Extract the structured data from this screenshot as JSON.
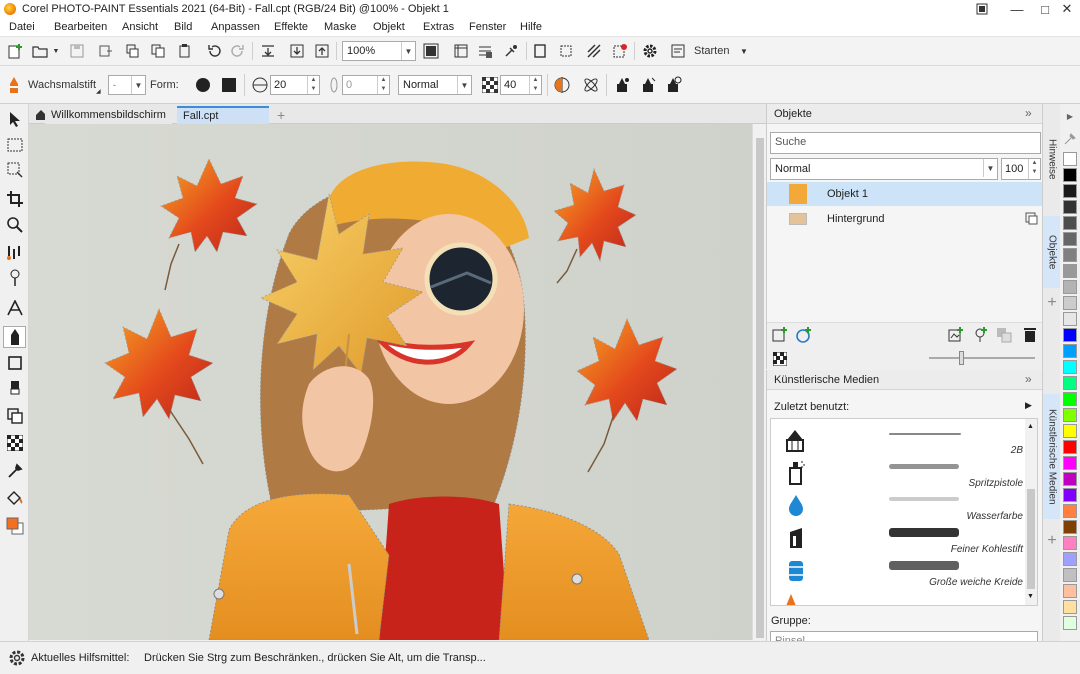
{
  "window": {
    "title": "Corel PHOTO-PAINT Essentials 2021 (64-Bit) - Fall.cpt (RGB/24 Bit) @100% - Objekt 1",
    "minimize": "—",
    "maximize": "□",
    "close": "✕"
  },
  "menu": [
    "Datei",
    "Bearbeiten",
    "Ansicht",
    "Bild",
    "Anpassen",
    "Effekte",
    "Maske",
    "Objekt",
    "Extras",
    "Fenster",
    "Hilfe"
  ],
  "toolbar": {
    "zoom": "100%",
    "launch_label": "Starten"
  },
  "propertybar": {
    "tool_name": "Wachsmalstift",
    "shape_label": "Form:",
    "nib_size": "20",
    "transparency": "0",
    "merge_mode": "Normal",
    "texture": "40",
    "size_combo": "-"
  },
  "document_tabs": [
    {
      "label": "Willkommensbildschirm",
      "active": false
    },
    {
      "label": "Fall.cpt",
      "active": true
    }
  ],
  "objects_panel": {
    "title": "Objekte",
    "search_placeholder": "Suche",
    "blend_mode": "Normal",
    "opacity": "100",
    "layers": [
      {
        "name": "Objekt 1",
        "selected": true
      },
      {
        "name": "Hintergrund",
        "selected": false
      }
    ]
  },
  "media_panel": {
    "title": "Künstlerische Medien",
    "recent_label": "Zuletzt benutzt:",
    "group_label": "Gruppe:",
    "group_value": "Pinsel",
    "brushes": [
      {
        "name": "2B",
        "icon": "pencil-icon"
      },
      {
        "name": "Spritzpistole",
        "icon": "spray-can-icon"
      },
      {
        "name": "Wasserfarbe",
        "icon": "water-drop-icon"
      },
      {
        "name": "Feiner Kohlestift",
        "icon": "charcoal-icon"
      },
      {
        "name": "Große weiche Kreide",
        "icon": "chalk-icon"
      }
    ]
  },
  "side_tabs": {
    "hints": "Hinweise",
    "objects": "Objekte",
    "media": "Künstlerische Medien"
  },
  "palette": [
    "#ffffff",
    "#000000",
    "#1a1a1a",
    "#333333",
    "#4d4d4d",
    "#666666",
    "#808080",
    "#999999",
    "#b3b3b3",
    "#cccccc",
    "#e6e6e6",
    "#0000ff",
    "#00a0ff",
    "#00ffff",
    "#00ff80",
    "#00ff00",
    "#80ff00",
    "#ffff00",
    "#ff0000",
    "#ff00ff",
    "#c000c0",
    "#8000ff",
    "#ff8040",
    "#804000",
    "#ff80c0",
    "#a0a0ff",
    "#c0c0c0",
    "#ffc0a0",
    "#ffe0a0",
    "#e0ffe0"
  ],
  "statusbar": {
    "tool_label": "Aktuelles Hilfsmittel:",
    "hint": "Drücken Sie Strg zum Beschränken., drücken Sie Alt, um die Transp..."
  }
}
